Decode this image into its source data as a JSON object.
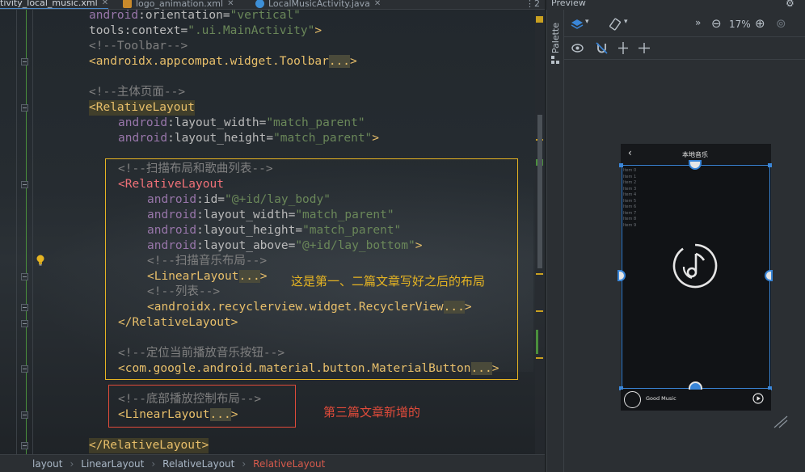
{
  "tabs": [
    {
      "label": "tivity_local_music.xml",
      "active": true
    },
    {
      "label": "logo_animation.xml",
      "active": false
    },
    {
      "label": "LocalMusicActivity.java",
      "active": false
    }
  ],
  "tab_overflow": "⋮2",
  "preview_title": "Preview",
  "palette_label": "Palette",
  "zoom": "17%",
  "code": {
    "l0": {
      "ns": "android",
      "attr": ":orientation=",
      "val": "\"vertical\""
    },
    "l1": {
      "attr": "tools:context=",
      "val": "\".ui.MainActivity\"",
      "tag": ">"
    },
    "l2": "<!--Toolbar-->",
    "l3": {
      "tag": "<androidx.appcompat.widget.Toolbar",
      "ell": "...",
      "end": ">"
    },
    "l5": "<!--主体页面-->",
    "l6": "<RelativeLayout",
    "l7": {
      "ns": "android",
      "attr": ":layout_width=",
      "val": "\"match_parent\""
    },
    "l8": {
      "ns": "android",
      "attr": ":layout_height=",
      "val": "\"match_parent\"",
      "tag": ">"
    },
    "l10": "<!--扫描布局和歌曲列表-->",
    "l11": "<RelativeLayout",
    "l12": {
      "ns": "android",
      "attr": ":id=",
      "val": "\"@+id/lay_body\""
    },
    "l13": {
      "ns": "android",
      "attr": ":layout_width=",
      "val": "\"match_parent\""
    },
    "l14": {
      "ns": "android",
      "attr": ":layout_height=",
      "val": "\"match_parent\""
    },
    "l15": {
      "ns": "android",
      "attr": ":layout_above=",
      "val": "\"@+id/lay_bottom\"",
      "tag": ">"
    },
    "l16": "<!--扫描音乐布局-->",
    "l17": {
      "tag": "<LinearLayout",
      "ell": "...",
      "end": ">"
    },
    "l18": "<!--列表-->",
    "l19": {
      "tag": "<androidx.recyclerview.widget.RecyclerView",
      "ell": "...",
      "end": ">"
    },
    "l20": "</RelativeLayout>",
    "l22": "<!--定位当前播放音乐按钮-->",
    "l23": {
      "tag": "<com.google.android.material.button.MaterialButton",
      "ell": "...",
      "end": ">"
    },
    "l25": "<!--底部播放控制布局-->",
    "l26": {
      "tag": "<LinearLayout",
      "ell": "...",
      "end": ">"
    },
    "l28": "</RelativeLayout>"
  },
  "annotations": {
    "yellow_note": "这是第一、二篇文章写好之后的布局",
    "red_note": "第三篇文章新增的"
  },
  "breadcrumbs": [
    "layout",
    "LinearLayout",
    "RelativeLayout",
    "RelativeLayout"
  ],
  "device": {
    "title": "本地音乐",
    "back": "‹",
    "list_items": [
      "Item 0",
      "Item 1",
      "Item 2",
      "Item 3",
      "Item 4",
      "Item 5",
      "Item 6",
      "Item 7",
      "Item 8",
      "Item 9"
    ],
    "bottom_label": "Good Music"
  },
  "colors": {
    "annotation_yellow": "#e6b422",
    "annotation_red": "#e04b3a",
    "selection_blue": "#3a86d8"
  }
}
